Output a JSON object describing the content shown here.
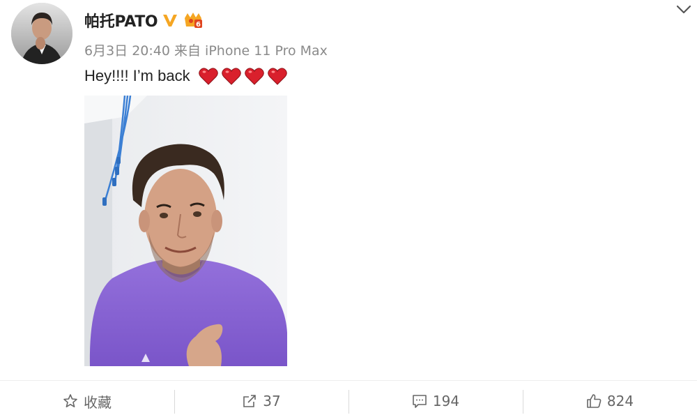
{
  "post": {
    "author": {
      "name": "帕托PATO"
    },
    "meta": "6月3日 20:40 来自 iPhone 11 Pro Max",
    "text": "Hey!!!! I’m back",
    "hearts": 4
  },
  "actions": [
    {
      "icon": "star-icon",
      "label": "收藏"
    },
    {
      "icon": "share-icon",
      "label": "37"
    },
    {
      "icon": "comment-icon",
      "label": "194"
    },
    {
      "icon": "like-icon",
      "label": "824"
    }
  ],
  "colors": {
    "verified": "#f5a623",
    "heart": "#d9202c",
    "shirt": "#8a63d2",
    "meta_text": "#8a8a8a"
  }
}
